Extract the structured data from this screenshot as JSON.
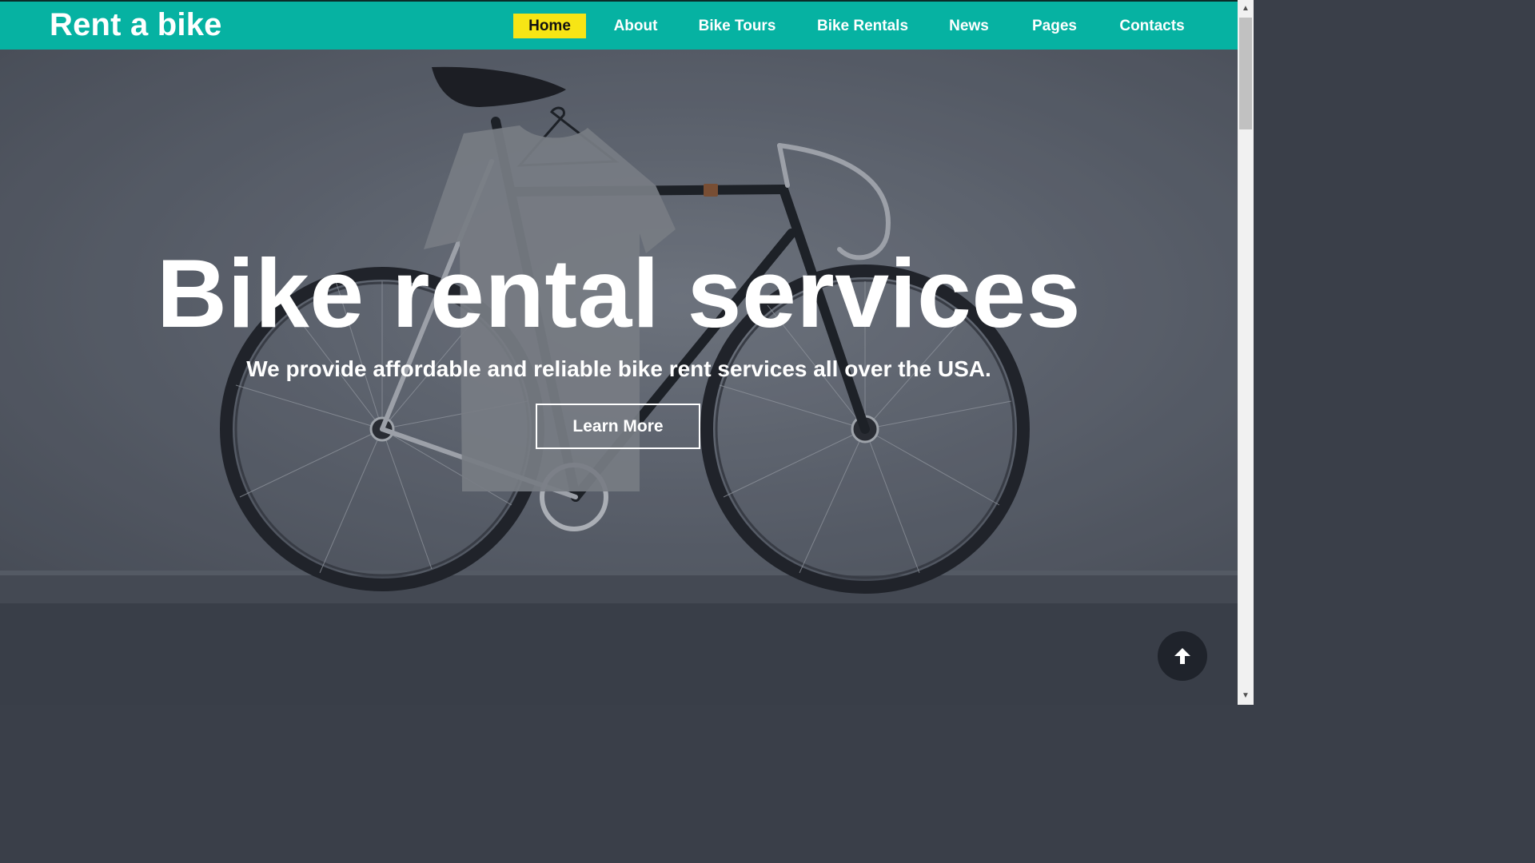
{
  "header": {
    "brand": "Rent a bike",
    "nav": [
      {
        "label": "Home",
        "active": true
      },
      {
        "label": "About",
        "active": false
      },
      {
        "label": "Bike Tours",
        "active": false
      },
      {
        "label": "Bike Rentals",
        "active": false
      },
      {
        "label": "News",
        "active": false
      },
      {
        "label": "Pages",
        "active": false
      },
      {
        "label": "Contacts",
        "active": false
      }
    ]
  },
  "hero": {
    "title": "Bike rental services",
    "subtitle": "We provide affordable and reliable bike rent services all over the USA.",
    "cta_label": "Learn More"
  },
  "icons": {
    "scroll_to_top": "arrow-up-icon",
    "scroll_up": "chevron-up-icon",
    "scroll_down": "chevron-down-icon"
  },
  "colors": {
    "header_bg": "#06b2a2",
    "active_nav_bg": "#f7e515",
    "page_bg": "#393e48"
  }
}
